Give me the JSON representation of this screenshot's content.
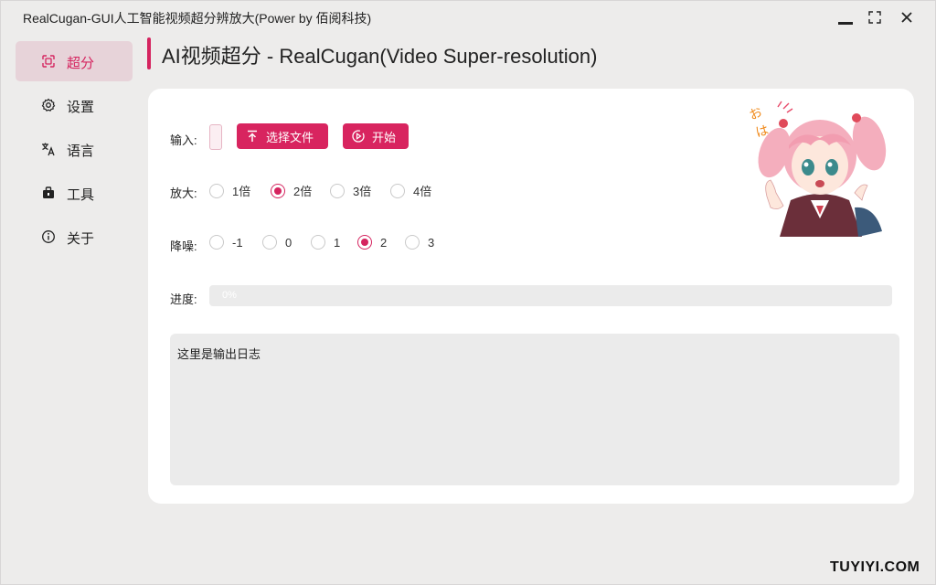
{
  "window": {
    "title": "RealCugan-GUI人工智能视频超分辨放大(Power by 佰阅科技)"
  },
  "sidebar": {
    "items": [
      {
        "label": "超分",
        "icon": "upscale-icon",
        "active": true
      },
      {
        "label": "设置",
        "icon": "gear-icon",
        "active": false
      },
      {
        "label": "语言",
        "icon": "translate-icon",
        "active": false
      },
      {
        "label": "工具",
        "icon": "toolbox-icon",
        "active": false
      },
      {
        "label": "关于",
        "icon": "info-icon",
        "active": false
      }
    ]
  },
  "page": {
    "title": "AI视频超分 - RealCugan(Video Super-resolution)"
  },
  "form": {
    "input_label": "输入:",
    "select_file_label": "选择文件",
    "start_label": "开始",
    "scale_label": "放大:",
    "scale_options": [
      "1倍",
      "2倍",
      "3倍",
      "4倍"
    ],
    "scale_selected": "2倍",
    "denoise_label": "降噪:",
    "denoise_options": [
      "-1",
      "0",
      "1",
      "2",
      "3"
    ],
    "denoise_selected": "2",
    "progress_label": "进度:",
    "progress_text": "0%",
    "progress_value": 0
  },
  "log": {
    "text": "这里是输出日志"
  },
  "watermark": "TUYIYI.COM",
  "colors": {
    "accent": "#d5245f",
    "accent_light": "#e7d3d9",
    "background": "#edeceb",
    "card": "#ffffff"
  }
}
